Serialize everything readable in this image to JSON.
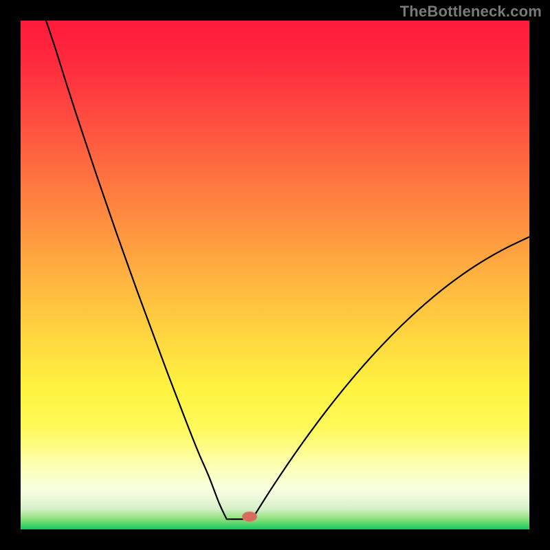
{
  "watermark": "TheBottleneck.com",
  "colors": {
    "curve": "#000000",
    "marker": "#d66c5e",
    "frame": "#000000"
  },
  "chart_data": {
    "type": "line",
    "title": "",
    "xlabel": "",
    "ylabel": "",
    "xlim": [
      0,
      100
    ],
    "ylim": [
      0,
      100
    ],
    "flat_bottom": {
      "x_start": 40.5,
      "x_end": 45.5,
      "y": 2
    },
    "marker": {
      "x": 45.0,
      "y": 2.5,
      "rx": 1.5,
      "ry": 1.0
    },
    "series": [
      {
        "name": "left-branch",
        "x": [
          5,
          7,
          9,
          11,
          13,
          15,
          17,
          19,
          21,
          23,
          25,
          27,
          29,
          31,
          33,
          35,
          37,
          39,
          40.5
        ],
        "y": [
          100,
          94.0,
          87.6,
          81.4,
          75.4,
          69.4,
          63.6,
          57.8,
          52.2,
          46.6,
          41.2,
          35.8,
          30.4,
          25.2,
          20.0,
          15.0,
          10.4,
          5.2,
          2.0
        ]
      },
      {
        "name": "right-branch",
        "x": [
          45.5,
          48,
          51,
          54,
          57,
          60,
          63,
          66,
          69,
          72,
          75,
          78,
          81,
          84,
          87,
          90,
          93,
          96,
          100
        ],
        "y": [
          2.0,
          6.0,
          10.6,
          15.0,
          19.2,
          23.2,
          27.0,
          30.6,
          34.0,
          37.2,
          40.2,
          43.0,
          45.6,
          48.0,
          50.2,
          52.2,
          54.0,
          55.6,
          57.5
        ]
      }
    ]
  }
}
